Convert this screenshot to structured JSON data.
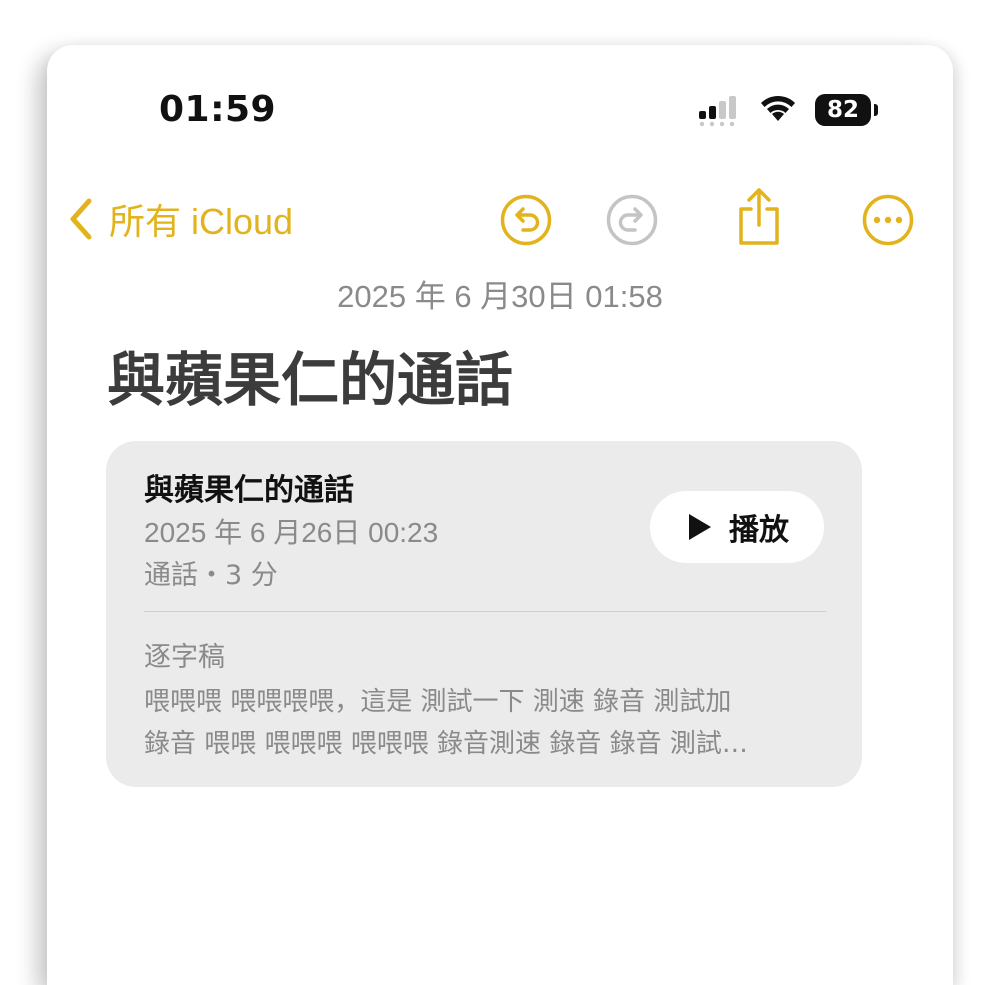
{
  "status_bar": {
    "time": "01:59",
    "battery_level": "82",
    "signal_icon": "cellular-signal-icon",
    "wifi_icon": "wifi-icon"
  },
  "nav": {
    "back_label": "所有 iCloud",
    "back_icon": "chevron-left-icon",
    "undo_icon": "undo-icon",
    "redo_icon": "redo-icon",
    "share_icon": "share-icon",
    "more_icon": "more-icon"
  },
  "note": {
    "date": "2025 年 6 月30日 01:58",
    "title": "與蘋果仁的通話"
  },
  "recording_card": {
    "title": "與蘋果仁的通話",
    "date": "2025 年 6 月26日 00:23",
    "meta": "通話・3 分",
    "play_label": "播放",
    "transcript_label": "逐字稿",
    "transcript_lines": [
      "喂喂喂 喂喂喂喂，這是 測試一下 測速 錄音 測試加",
      "錄音 喂喂 喂喂喂 喂喂喂 錄音測速 錄音 錄音 測試…"
    ]
  },
  "colors": {
    "accent": "#e2b31c",
    "disabled": "#c4c4c4",
    "secondary_text": "#8a8a8a",
    "card_bg": "#ebebeb"
  }
}
